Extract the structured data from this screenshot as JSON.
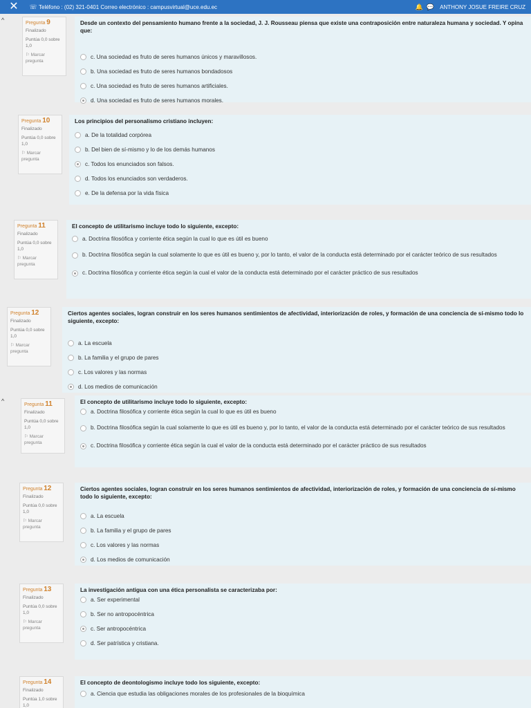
{
  "topbar": {
    "contact": "Teléfono : (02) 321-0401  Correo electrónico : campusvirtual@uce.edu.ec",
    "user": "ANTHONY JOSUE FREIRE CRUZ",
    "icons": [
      "close-icon",
      "phone-icon",
      "mail-icon",
      "bell-icon",
      "chat-icon"
    ]
  },
  "questions": [
    {
      "label": "Pregunta",
      "number": "9",
      "state": "Finalizado",
      "score": "Puntúa 0,0 sobre 1,0",
      "flag": "Marcar pregunta",
      "text": "Desde un contexto del pensamiento humano frente a la sociedad, J. J. Rousseau piensa que existe una contraposición entre naturaleza humana y sociedad. Y opina que:",
      "options": [
        "c. Una sociedad es fruto de seres humanos únicos y maravillosos.",
        "b. Una sociedad es fruto de seres humanos bondadosos",
        "c. Una sociedad es fruto de seres humanos artificiales.",
        "d. Una sociedad es fruto de seres humanos morales."
      ],
      "selected": 3
    },
    {
      "label": "Pregunta",
      "number": "10",
      "state": "Finalizado",
      "score": "Puntúa 0,0 sobre 1,0",
      "flag": "Marcar pregunta",
      "text": "Los principios del personalismo cristiano incluyen:",
      "options": [
        "a. De la totalidad corpórea",
        "b. Del bien de sí-mismo y lo de los demás humanos",
        "c. Todos los enunciados son falsos.",
        "d. Todos los enunciados son verdaderos.",
        "e. De la defensa por la vida física"
      ],
      "selected": 2
    },
    {
      "label": "Pregunta",
      "number": "11",
      "state": "Finalizado",
      "score": "Puntúa 0,0 sobre 1,0",
      "flag": "Marcar pregunta",
      "text": "El concepto de utilitarismo incluye todo lo siguiente, excepto:",
      "options": [
        "a. Doctrina filosófica y corriente ética según la cual lo que es útil es bueno",
        "b. Doctrina filosófica según la cual solamente lo que es útil es bueno y, por lo tanto, el valor de la conducta está determinado por el carácter teórico de sus resultados",
        "c. Doctrina filosófica y corriente ética según la cual el valor de la conducta está determinado por el carácter práctico de sus resultados"
      ],
      "selected": 2
    },
    {
      "label": "Pregunta",
      "number": "12",
      "state": "Finalizado",
      "score": "Puntúa 0,0 sobre 1,0",
      "flag": "Marcar pregunta",
      "text": "Ciertos agentes sociales, logran construir en los seres humanos sentimientos de afectividad, interiorización de roles, y formación de una conciencia de sí-mismo todo lo siguiente, excepto:",
      "options": [
        "a. La escuela",
        "b. La familia y el grupo de pares",
        "c. Los valores y las normas",
        "d. Los medios de comunicación"
      ],
      "selected": 3
    },
    {
      "label": "Pregunta",
      "number": "11",
      "state": "Finalizado",
      "score": "Puntúa 0,0 sobre 1,0",
      "flag": "Marcar pregunta",
      "text": "El concepto de utilitarismo incluye todo lo siguiente, excepto:",
      "options": [
        "a. Doctrina filosófica y corriente ética según la cual lo que es útil es bueno",
        "b. Doctrina filosófica según la cual solamente lo que es útil es bueno y, por lo tanto, el valor de la conducta está determinado por el carácter teórico de sus resultados",
        "c. Doctrina filosófica y corriente ética según la cual el valor de la conducta está determinado por el carácter práctico de sus resultados"
      ],
      "selected": 2
    },
    {
      "label": "Pregunta",
      "number": "12",
      "state": "Finalizado",
      "score": "Puntúa 0,0 sobre 1,0",
      "flag": "Marcar pregunta",
      "text": "Ciertos agentes sociales, logran construir en los seres humanos sentimientos de afectividad, interiorización de roles, y formación de una conciencia de sí-mismo todo lo siguiente, excepto:",
      "options": [
        "a. La escuela",
        "b. La familia y el grupo de pares",
        "c. Los valores y las normas",
        "d. Los medios de comunicación"
      ],
      "selected": 3
    },
    {
      "label": "Pregunta",
      "number": "13",
      "state": "Finalizado",
      "score": "Puntúa 0,0 sobre 1,0",
      "flag": "Marcar pregunta",
      "text": "La investigación antigua con una ética personalista se caracterizaba por:",
      "options": [
        "a. Ser experimental",
        "b. Ser no antropocéntrica",
        "c. Ser antropocéntrica",
        "d. Ser patrística y cristiana."
      ],
      "selected": 2
    },
    {
      "label": "Pregunta",
      "number": "14",
      "state": "Finalizado",
      "score": "Puntúa 1,0 sobre 1,0",
      "flag": "Marcar pregunta",
      "text": "El concepto de deontologismo incluye todo los siguiente, excepto:",
      "options": [
        "a. Ciencia que estudia las obligaciones morales de los profesionales de la bioquímica"
      ],
      "selected": -1
    }
  ]
}
